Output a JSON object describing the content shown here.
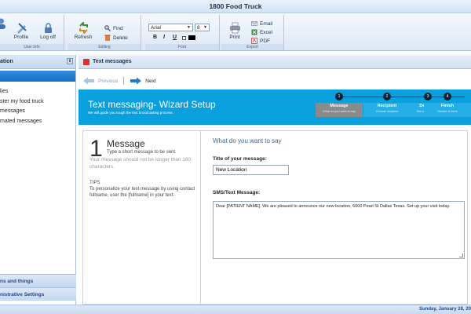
{
  "window": {
    "title": "1800 Food Truck"
  },
  "ribbon": {
    "user_info": {
      "label": "User Info",
      "buttons": [
        {
          "label": "Profile",
          "icon": "profile-icon"
        },
        {
          "label": "Log off",
          "icon": "lock-icon"
        }
      ],
      "partial_first_icon": "user-icon"
    },
    "editing": {
      "label": "Editing",
      "refresh": "Refresh",
      "find": "Find",
      "delete": "Delete"
    },
    "font": {
      "label": "Font",
      "family": "Arial",
      "size": "8",
      "bold": "B",
      "italic": "I",
      "underline": "U"
    },
    "export": {
      "label": "Export",
      "print": "Print",
      "email": "Email",
      "excel": "Excel",
      "pdf": "PDF"
    }
  },
  "sidebar": {
    "header": "ation",
    "items": [
      {
        "label": "lies"
      },
      {
        "label": "ster my food truck"
      },
      {
        "label": " messages"
      },
      {
        "label": "mated messages"
      }
    ],
    "bottom_sections": [
      {
        "label": "ns and things"
      },
      {
        "label": "nistrative Settings"
      }
    ]
  },
  "main": {
    "tab_title": "Text messages",
    "nav": {
      "previous": "Previous",
      "next": "Next"
    },
    "banner": {
      "title": "Text messaging- Wizard Setup",
      "subtitle": "We will guide you tough the text broadcasting process."
    },
    "steps": [
      {
        "num": "1",
        "label": "Message",
        "desc": "What do you want to say",
        "active": true
      },
      {
        "num": "2",
        "label": "Recipient",
        "desc": "Choose recipient",
        "active": false
      },
      {
        "num": "3",
        "label": "Delivery",
        "desc": "Set delivery date",
        "active": false
      },
      {
        "num": "4",
        "label": "Finish",
        "desc": "Review & done",
        "active": false
      }
    ],
    "left_info": {
      "number": "1",
      "title": "Message",
      "subtitle": "Type a short message to be sent.",
      "subtitle2": "Your message should not be longer than 160 characters.",
      "tips": "TIPS\nTo personalize your text message by using contact fullname, user the [fullname] in your text."
    },
    "form": {
      "question": "What do you want to say",
      "title_label": "Title of your message:",
      "title_value": "New Location",
      "sms_label": "SMS/Text Message:",
      "sms_value": "Dear [PATIENT NAME]. We are pleased to announce our new location, 6000 Pearl St Dallas Texas. Set up your visit today."
    }
  },
  "status": {
    "date": "Sunday, January 28, 201"
  },
  "colors": {
    "banner": "#0aa0de",
    "accent": "#1a6fc2",
    "step_active": "#8a8a8a"
  }
}
